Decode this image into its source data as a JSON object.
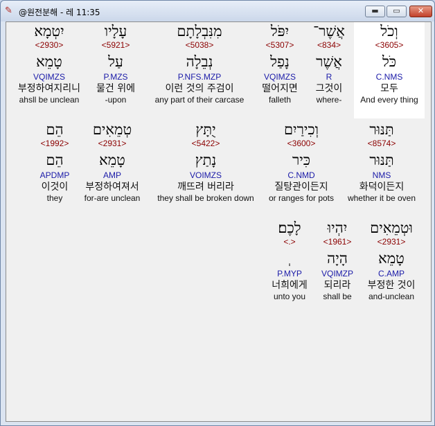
{
  "window": {
    "title": "@원전분해 - 레 11:35",
    "icon": "bible-app-icon",
    "min_glyph": "▬",
    "max_glyph": "▭",
    "close_glyph": "✕"
  },
  "words": [
    {
      "heb": "וְכֹל",
      "strong": "<3605>",
      "lemma": "כֹּל",
      "parse": "C.NMS",
      "kor": "모두",
      "eng": "And every thing",
      "selected": true
    },
    {
      "heb": "אֲשֶׁר־",
      "strong": "<834>",
      "lemma": "אֲשֶׁר",
      "parse": "R",
      "kor": "그것이",
      "eng": "where-"
    },
    {
      "heb": "יִפֹּל",
      "strong": "<5307>",
      "lemma": "נָפַל",
      "parse": "VQIMZS",
      "kor": "떨어지면",
      "eng": "falleth"
    },
    {
      "heb": "מִנִּבְלָתָם",
      "strong": "<5038>",
      "lemma": "נְבֵלָה",
      "parse": "P.NFS.MZP",
      "kor": "이런 것의 주검이",
      "eng": "any part of their carcase"
    },
    {
      "heb": "עָלָיו",
      "strong": "<5921>",
      "lemma": "עַל",
      "parse": "P.MZS",
      "kor": "물건 위에",
      "eng": "-upon"
    },
    {
      "heb": "יִטְמָא",
      "strong": "<2930>",
      "lemma": "טָמֵא",
      "parse": "VQIMZS",
      "kor": "부정하여지리니",
      "eng": "ahsll be unclean"
    },
    {
      "heb": "תַּנּוּר",
      "strong": "<8574>",
      "lemma": "תַּנּוּר",
      "parse": "NMS",
      "kor": "화덕이든지",
      "eng": "whether it be oven"
    },
    {
      "heb": "וְכִירַיִם",
      "strong": "<3600>",
      "lemma": "כִּיר",
      "parse": "C.NMD",
      "kor": "질탕관이든지",
      "eng": "or ranges for pots"
    },
    {
      "heb": "יֻתָּץ",
      "strong": "<5422>",
      "lemma": "נָתַץ",
      "parse": "VOIMZS",
      "kor": "깨뜨려 버리라",
      "eng": "they shall be broken down"
    },
    {
      "heb": "טְמֵאִים",
      "strong": "<2931>",
      "lemma": "טָמֵא",
      "parse": "AMP",
      "kor": "부정하여져서",
      "eng": "for-are unclean"
    },
    {
      "heb": "הֵם",
      "strong": "<1992>",
      "lemma": "הֵם",
      "parse": "APDMP",
      "kor": "이것이",
      "eng": "they"
    },
    {
      "heb": "וּטְמֵאִים",
      "strong": "<2931>",
      "lemma": "טָמֵא",
      "parse": "C.AMP",
      "kor": "부정한 것이",
      "eng": "and-unclean"
    },
    {
      "heb": "יִהְיוּ",
      "strong": "<1961>",
      "lemma": "הָיָה",
      "parse": "VQIMZP",
      "kor": "되리라",
      "eng": "shall be"
    },
    {
      "heb": "לָכֶם׃",
      "strong": "<.>",
      "lemma": "ְ",
      "parse": "P.MYP",
      "kor": "너희에게",
      "eng": "unto you"
    }
  ]
}
